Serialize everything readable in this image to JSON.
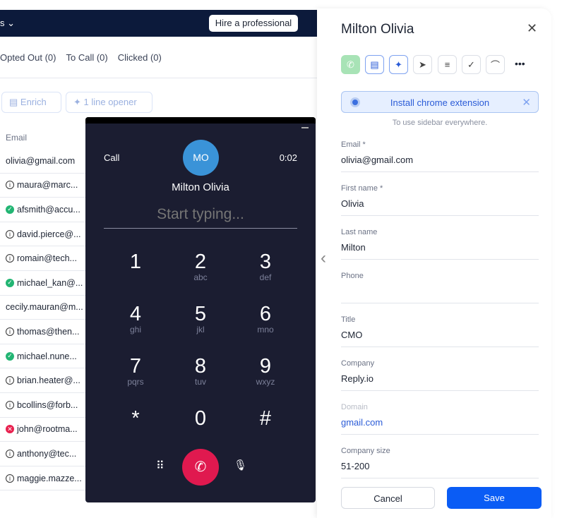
{
  "nav": {
    "menu_label": "s ⌄",
    "hire_button": "Hire a professional"
  },
  "tabs": [
    "Opted Out (0)",
    "To Call (0)",
    "Clicked (0)"
  ],
  "toolbar": {
    "enrich": "Enrich",
    "opener": "1 line opener"
  },
  "table": {
    "column": "Email",
    "rows": [
      {
        "email": "olivia@gmail.com",
        "status": "none"
      },
      {
        "email": "maura@marc...",
        "status": "info"
      },
      {
        "email": "afsmith@accu...",
        "status": "valid"
      },
      {
        "email": "david.pierce@...",
        "status": "info"
      },
      {
        "email": "romain@tech...",
        "status": "info"
      },
      {
        "email": "michael_kan@...",
        "status": "valid"
      },
      {
        "email": "cecily.mauran@m...",
        "status": "none"
      },
      {
        "email": "thomas@then...",
        "status": "info"
      },
      {
        "email": "michael.nune...",
        "status": "valid"
      },
      {
        "email": "brian.heater@...",
        "status": "info"
      },
      {
        "email": "bcollins@forb...",
        "status": "info"
      },
      {
        "email": "john@rootma...",
        "status": "invalid"
      },
      {
        "email": "anthony@tec...",
        "status": "info"
      },
      {
        "email": "maggie.mazze...",
        "status": "info"
      }
    ]
  },
  "dialer": {
    "label": "Call",
    "initials": "MO",
    "timer": "0:02",
    "name": "Milton Olivia",
    "placeholder": "Start typing...",
    "keys": [
      {
        "d": "1",
        "l": ""
      },
      {
        "d": "2",
        "l": "abc"
      },
      {
        "d": "3",
        "l": "def"
      },
      {
        "d": "4",
        "l": "ghi"
      },
      {
        "d": "5",
        "l": "jkl"
      },
      {
        "d": "6",
        "l": "mno"
      },
      {
        "d": "7",
        "l": "pqrs"
      },
      {
        "d": "8",
        "l": "tuv"
      },
      {
        "d": "9",
        "l": "wxyz"
      },
      {
        "d": "*",
        "l": ""
      },
      {
        "d": "0",
        "l": ""
      },
      {
        "d": "#",
        "l": ""
      }
    ],
    "hangup_color": "#e0194f"
  },
  "panel": {
    "title": "Milton Olivia",
    "banner": "Install chrome extension",
    "banner_sub": "To use sidebar everywhere.",
    "fields": [
      {
        "k": "Email *",
        "v": "olivia@gmail.com"
      },
      {
        "k": "First name *",
        "v": "Olivia"
      },
      {
        "k": "Last name",
        "v": "Milton"
      },
      {
        "k": "Phone",
        "v": ""
      },
      {
        "k": "Title",
        "v": "CMO"
      },
      {
        "k": "Company",
        "v": "Reply.io"
      },
      {
        "k": "Domain",
        "v": "gmail.com"
      },
      {
        "k": "Company size",
        "v": "51-200"
      }
    ],
    "cancel": "Cancel",
    "save": "Save",
    "accent": "#0a5cf5"
  }
}
